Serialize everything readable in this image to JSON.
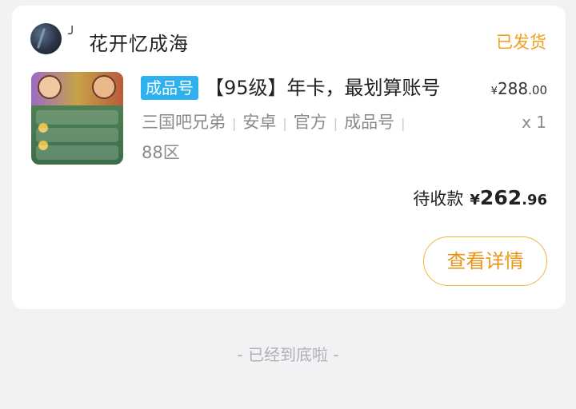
{
  "order": {
    "shop_mark": "╯",
    "shop_name": "花开忆成海",
    "status": "已发货",
    "tag": "成品号",
    "title": "【95级】年卡，最划算账号",
    "price": {
      "symbol": "¥",
      "integer": "288",
      "decimal": ".00"
    },
    "specs": [
      "三国吧兄弟",
      "安卓",
      "官方",
      "成品号",
      "88区"
    ],
    "spec_separator": "|",
    "quantity": "x 1",
    "total": {
      "label": "待收款",
      "symbol": "¥",
      "integer": "262",
      "decimal": ".96"
    },
    "detail_button": "查看详情"
  },
  "footer": "- 已经到底啦 -",
  "colors": {
    "accent": "#f0a01a",
    "tag_bg": "#2fb1f0",
    "page_bg": "#f2f2f4"
  },
  "icons": {
    "avatar": "user-avatar",
    "thumbnail": "product-thumbnail"
  }
}
